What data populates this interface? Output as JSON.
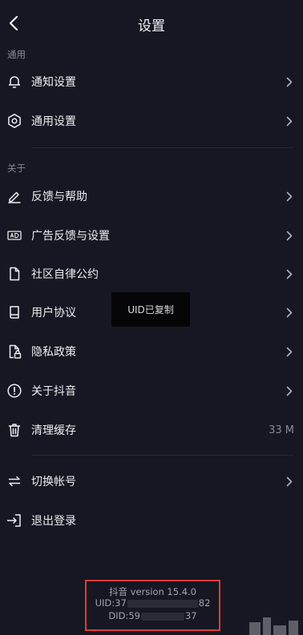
{
  "header": {
    "title": "设置"
  },
  "sections": [
    {
      "label": "通用",
      "items": [
        {
          "label": "通知设置",
          "icon": "bell-icon"
        },
        {
          "label": "通用设置",
          "icon": "gear-icon"
        }
      ]
    },
    {
      "label": "关于",
      "items": [
        {
          "label": "反馈与帮助",
          "icon": "pencil-icon"
        },
        {
          "label": "广告反馈与设置",
          "icon": "ad-icon"
        },
        {
          "label": "社区自律公约",
          "icon": "document-icon"
        },
        {
          "label": "用户协议",
          "icon": "book-icon"
        },
        {
          "label": "隐私政策",
          "icon": "lock-document-icon"
        },
        {
          "label": "关于抖音",
          "icon": "info-icon"
        },
        {
          "label": "清理缓存",
          "icon": "trash-icon",
          "value": "33 M"
        }
      ]
    }
  ],
  "account": {
    "switch_label": "切换帐号",
    "logout_label": "退出登录"
  },
  "toast": {
    "text": "UID已复制"
  },
  "version": {
    "app_line": "抖音 version 15.4.0",
    "uid_prefix": "UID:37",
    "uid_suffix": "82",
    "did_prefix": "DID:59",
    "did_suffix": "37"
  },
  "colors": {
    "background": "#161722",
    "text": "#ededf1",
    "muted": "#8a8b96",
    "highlight_border": "#e23a3a"
  }
}
